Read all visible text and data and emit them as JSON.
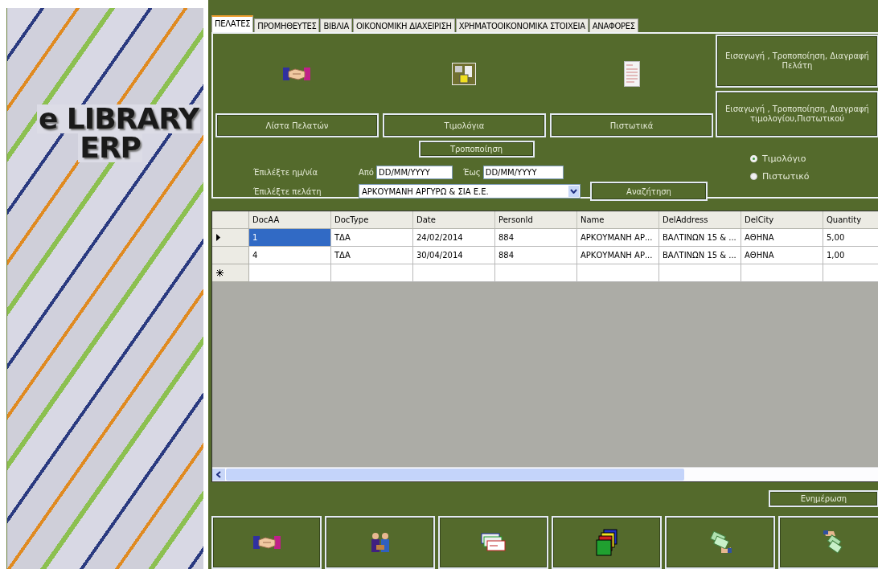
{
  "logo": {
    "line1": "e LIBRARY",
    "line2": "ERP"
  },
  "tabs": [
    {
      "label": "ΠΕΛΑΤΕΣ",
      "selected": true
    },
    {
      "label": "ΠΡΟΜΗΘΕΥΤΕΣ",
      "selected": false
    },
    {
      "label": "ΒΙΒΛΙΑ",
      "selected": false
    },
    {
      "label": "ΟΙΚΟΝΟΜΙΚΗ ΔΙΑΧΕΙΡΙΣΗ",
      "selected": false
    },
    {
      "label": "ΧΡΗΜΑΤΟΟΙΚΟΝΟΜΙΚΑ ΣΤΟΙΧΕΙΑ",
      "selected": false
    },
    {
      "label": "ΑΝΑΦΟΡΕΣ",
      "selected": false
    }
  ],
  "panel": {
    "main_buttons": [
      "Λίστα Πελατών",
      "Τιμολόγια",
      "Πιστωτικά"
    ],
    "side_buttons": [
      "Εισαγωγή , Τροποποίηση, Διαγραφή Πελάτη",
      "Εισαγωγή , Τροποποίηση, Διαγραφή τιμολογίου,Πιστωτικού"
    ],
    "modify_button": "Τροποποίηση",
    "date_label": "Έπιλέξτε ημ/νία",
    "from_label": "Από",
    "from_value": "DD/MM/YYYY",
    "to_label": "Έως",
    "to_value": "DD/MM/YYYY",
    "customer_label": "Έπιλέξτε πελάτη",
    "customer_value": "ΑΡΚΟΥΜΑΝΗ ΑΡΓΥΡΩ & ΣΙΑ Ε.Ε.",
    "search_button": "Αναζήτηση",
    "radios": [
      {
        "label": "Τιμολόγιο",
        "selected": true
      },
      {
        "label": "Πιστωτικό",
        "selected": false
      }
    ]
  },
  "grid": {
    "columns": [
      "DocAA",
      "DocType",
      "Date",
      "PersonId",
      "Name",
      "DelAddress",
      "DelCity",
      "Quantity"
    ],
    "rows": [
      {
        "cells": [
          "1",
          "ΤΔΑ",
          "24/02/2014",
          "884",
          "ΑΡΚΟΥΜΑΝΗ ΑΡ...",
          "ΒΑΛΤΙΝΩΝ 15 & ...",
          "ΑΘΗΝΑ",
          "5,00"
        ],
        "selected": true
      },
      {
        "cells": [
          "4",
          "ΤΔΑ",
          "30/04/2014",
          "884",
          "ΑΡΚΟΥΜΑΝΗ ΑΡ...",
          "ΒΑΛΤΙΝΩΝ 15 & ...",
          "ΑΘΗΝΑ",
          "1,00"
        ],
        "selected": false
      }
    ],
    "new_row": true
  },
  "update_button": "Ενημέρωση"
}
